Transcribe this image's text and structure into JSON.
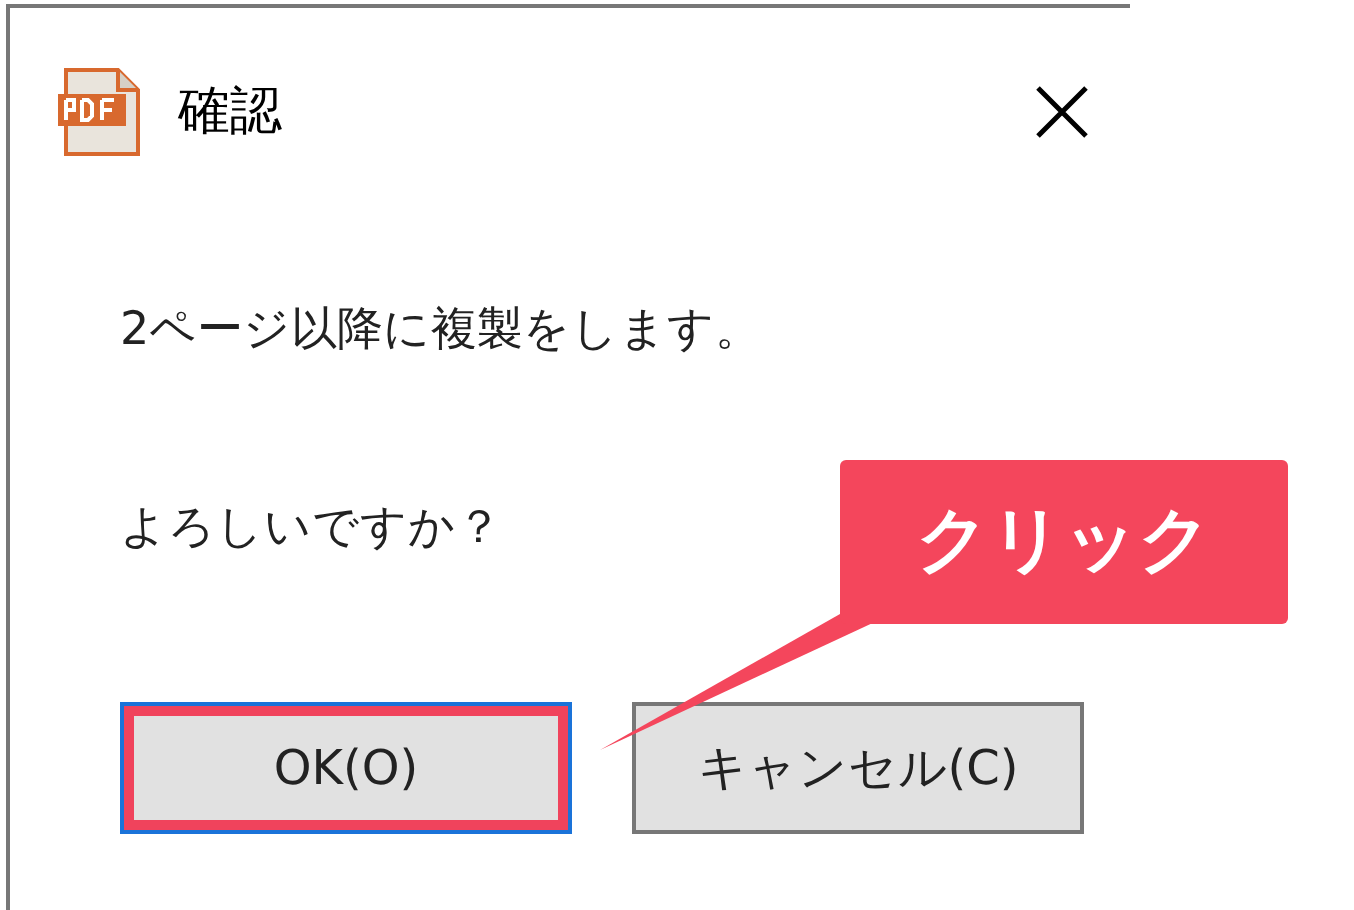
{
  "window": {
    "title": "確認"
  },
  "message": [
    "2ページ以降に複製をします。",
    "よろしいですか？"
  ],
  "buttons": [
    {
      "label": "OK(O)",
      "default": true,
      "highlighted": true
    },
    {
      "label": "キャンセル(C)",
      "default": false,
      "highlighted": false
    }
  ],
  "callout": {
    "text": "クリック"
  }
}
